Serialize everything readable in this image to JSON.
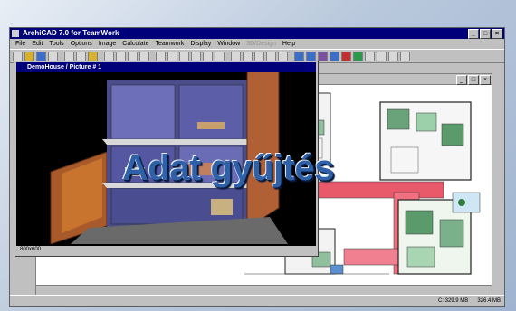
{
  "app": {
    "title": "ArchiCAD 7.0 for TeamWork",
    "window_buttons": [
      "_",
      "□",
      "×"
    ]
  },
  "menubar": {
    "items": [
      "File",
      "Edit",
      "Tools",
      "Options",
      "Image",
      "Calculate",
      "Teamwork",
      "Display",
      "Window",
      "3D/Design",
      "Help"
    ],
    "dim_items": [
      "3D/Design"
    ]
  },
  "picture_window": {
    "title": "DemoHouse / Picture # 1",
    "status": "800x600"
  },
  "plan_window": {
    "buttons": [
      "_",
      "□",
      "×"
    ]
  },
  "statusbar": {
    "disk": "C: 329.9 MB",
    "memory": "326.4 MB"
  },
  "overlay": {
    "headline": "Adat gyűjtés"
  },
  "colors": {
    "title_bar": "#00007b",
    "headline": "#2e61a8",
    "chrome": "#c0c0c0"
  }
}
